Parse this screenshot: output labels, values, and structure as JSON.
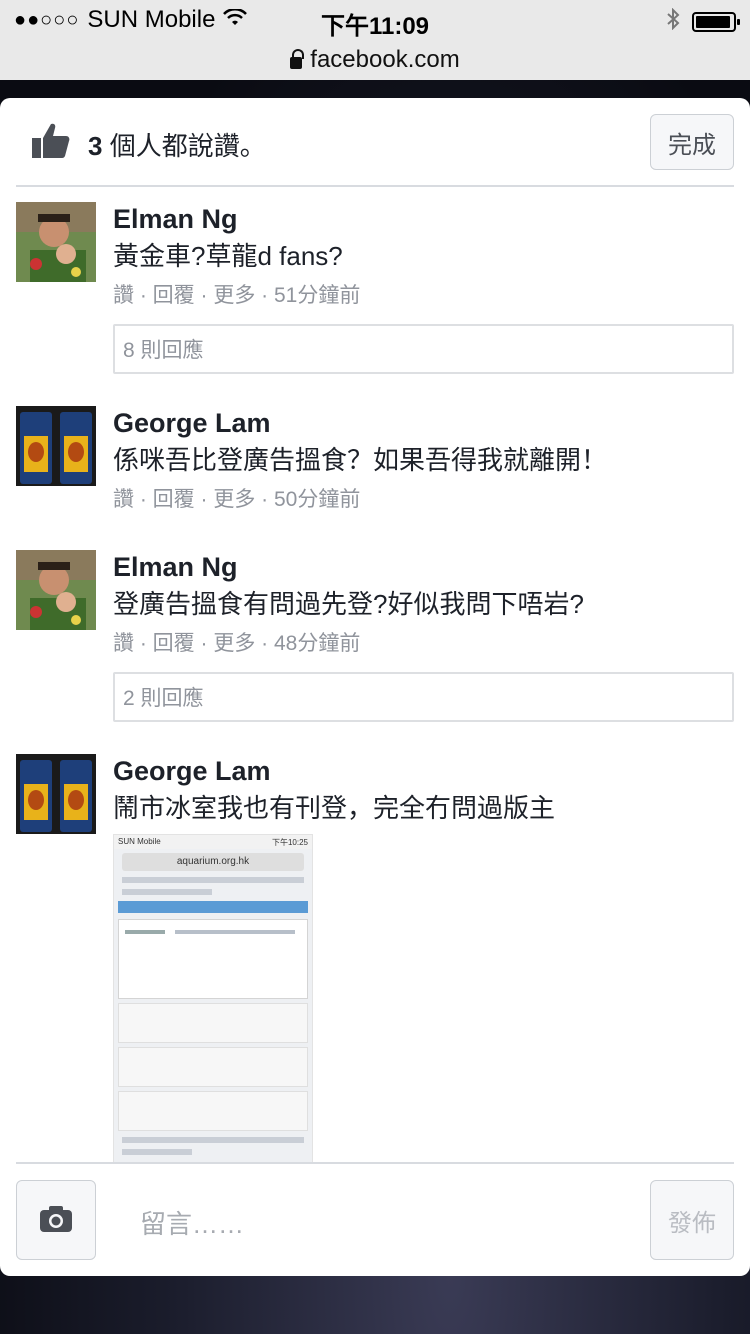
{
  "status_bar": {
    "signal": "●●○○○",
    "carrier": "SUN Mobile",
    "time": "下午11:09"
  },
  "url_bar": {
    "url": "facebook.com"
  },
  "header": {
    "like_count": "3",
    "like_text": " 個人都說讚。",
    "done_label": "完成"
  },
  "comments": [
    {
      "author": "Elman Ng",
      "text": "黃金車?草龍d fans?",
      "meta": "讚 · 回覆 · 更多 · 51分鐘前",
      "replies": "8 則回應"
    },
    {
      "author": "George Lam",
      "text": "係咪吾比登廣告搵食？如果吾得我就離開！",
      "meta": "讚 · 回覆 · 更多 · 50分鐘前"
    },
    {
      "author": "Elman Ng",
      "text": "登廣告搵食有問過先登?好似我問下唔岩?",
      "meta": "讚 · 回覆 · 更多 · 48分鐘前",
      "replies": "2 則回應"
    },
    {
      "author": "George Lam",
      "text": "鬧市冰室我也有刊登，完全冇問過版主",
      "attachment": {
        "carrier": "SUN Mobile",
        "time": "下午10:25",
        "url": "aquarium.org.hk"
      }
    }
  ],
  "composer": {
    "placeholder": "留言……",
    "post_label": "發佈"
  },
  "icons": {
    "thumb": "thumbs-up-icon",
    "camera": "camera-icon",
    "lock": "lock-icon",
    "wifi": "wifi-icon",
    "bluetooth": "bluetooth-icon",
    "battery": "battery-icon"
  },
  "colors": {
    "thumb": "#4b4f56",
    "text": "#1d2129",
    "meta": "#90949c"
  }
}
